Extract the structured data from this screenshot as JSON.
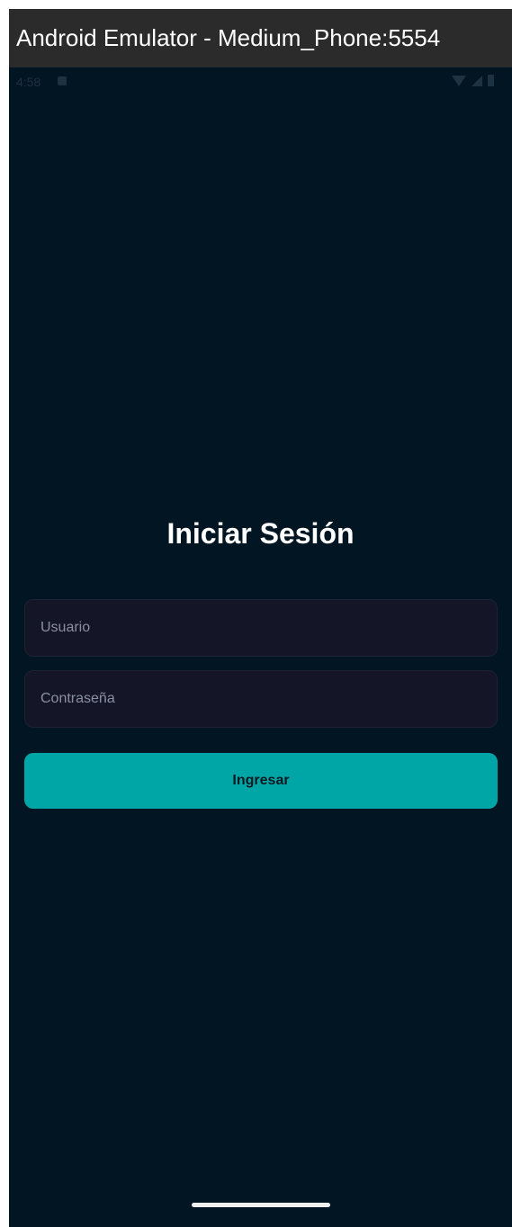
{
  "window": {
    "title": "Android Emulator - Medium_Phone:5554"
  },
  "status_bar": {
    "time": "4:58",
    "icons": [
      "notification-icon",
      "wifi-icon",
      "signal-icon",
      "battery-icon"
    ]
  },
  "login": {
    "title": "Iniciar Sesión",
    "username_placeholder": "Usuario",
    "username_value": "",
    "password_placeholder": "Contraseña",
    "password_value": "",
    "submit_label": "Ingresar"
  },
  "colors": {
    "background": "#011522",
    "field_background": "#141627",
    "accent": "#00a6a6",
    "titlebar": "#2b2b2b"
  }
}
